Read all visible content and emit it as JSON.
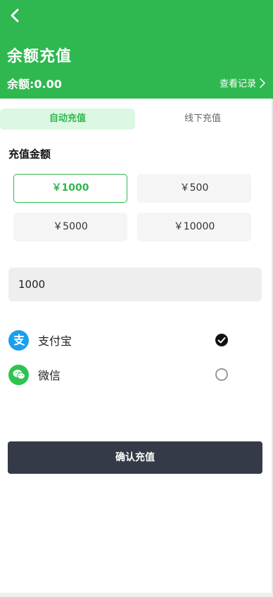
{
  "header": {
    "title": "余额充值",
    "balance": "余额:0.00",
    "records_link": "查看记录"
  },
  "tabs": [
    {
      "label": "自动充值",
      "active": true
    },
    {
      "label": "线下充值",
      "active": false
    }
  ],
  "amount_section": {
    "title": "充值金额",
    "options": [
      {
        "label": "￥1000",
        "selected": true
      },
      {
        "label": "￥500",
        "selected": false
      },
      {
        "label": "￥5000",
        "selected": false
      },
      {
        "label": "￥10000",
        "selected": false
      }
    ],
    "input_value": "1000"
  },
  "payment_methods": [
    {
      "name": "支付宝",
      "icon": "alipay-icon",
      "selected": true
    },
    {
      "name": "微信",
      "icon": "wechat-icon",
      "selected": false
    }
  ],
  "confirm_button": "确认充值",
  "colors": {
    "brand_green": "#2eb84f",
    "tab_active_bg": "#dcf7e2",
    "alipay_blue": "#1aa0ee",
    "wechat_green": "#2cc44f",
    "button_dark": "#353a48"
  }
}
